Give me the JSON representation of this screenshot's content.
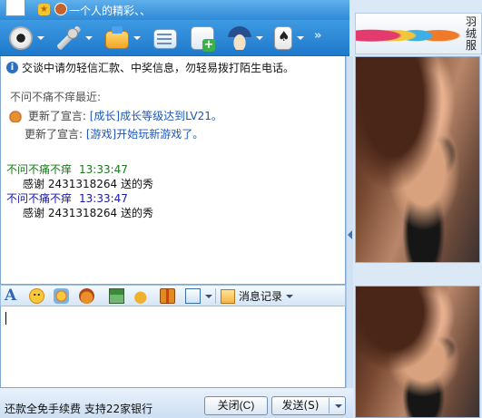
{
  "title_bar": {
    "signature": "一个人的精彩、、"
  },
  "toolbar": {
    "buttons": [
      {
        "name": "video",
        "icon": "camera-icon"
      },
      {
        "name": "voice",
        "icon": "microphone-icon"
      },
      {
        "name": "file",
        "icon": "folder-icon"
      },
      {
        "name": "mail",
        "icon": "mail-icon"
      },
      {
        "name": "app",
        "icon": "add-app-icon"
      },
      {
        "name": "remote",
        "icon": "cap-icon"
      },
      {
        "name": "game",
        "icon": "cards-icon"
      }
    ],
    "more": "»"
  },
  "chat": {
    "notice": "交谈中请勿轻信汇款、中奖信息，勿轻易拨打陌生电话。",
    "recent_header": "不问不痛不痒最近:",
    "updates": [
      {
        "prefix": "更新了宣言:",
        "link": "[成长]成长等级达到LV21。"
      },
      {
        "prefix": "更新了宣言:",
        "link": "[游戏]开始玩新游戏了。"
      }
    ],
    "messages": [
      {
        "sender": "不问不痛不痒",
        "time": "13:33:47",
        "color": "#1a7a1a",
        "body": "感谢 2431318264 送的秀"
      },
      {
        "sender": "不问不痛不痒",
        "time": "13:33:47",
        "color": "#1a1aa8",
        "body": "感谢 2431318264 送的秀"
      }
    ]
  },
  "format_bar": {
    "font_glyph": "A",
    "history_label": "消息记录"
  },
  "bottom": {
    "promo": "还款全免手续费 支持22家银行",
    "close_label": "关闭(C)",
    "send_label": "发送(S)"
  },
  "side": {
    "ad_text": "羽绒服"
  },
  "colors": {
    "toolbar": "#2f8ad6",
    "link": "#1d57b8",
    "time_green": "#1a7a1a",
    "time_blue": "#1a1aa8"
  }
}
